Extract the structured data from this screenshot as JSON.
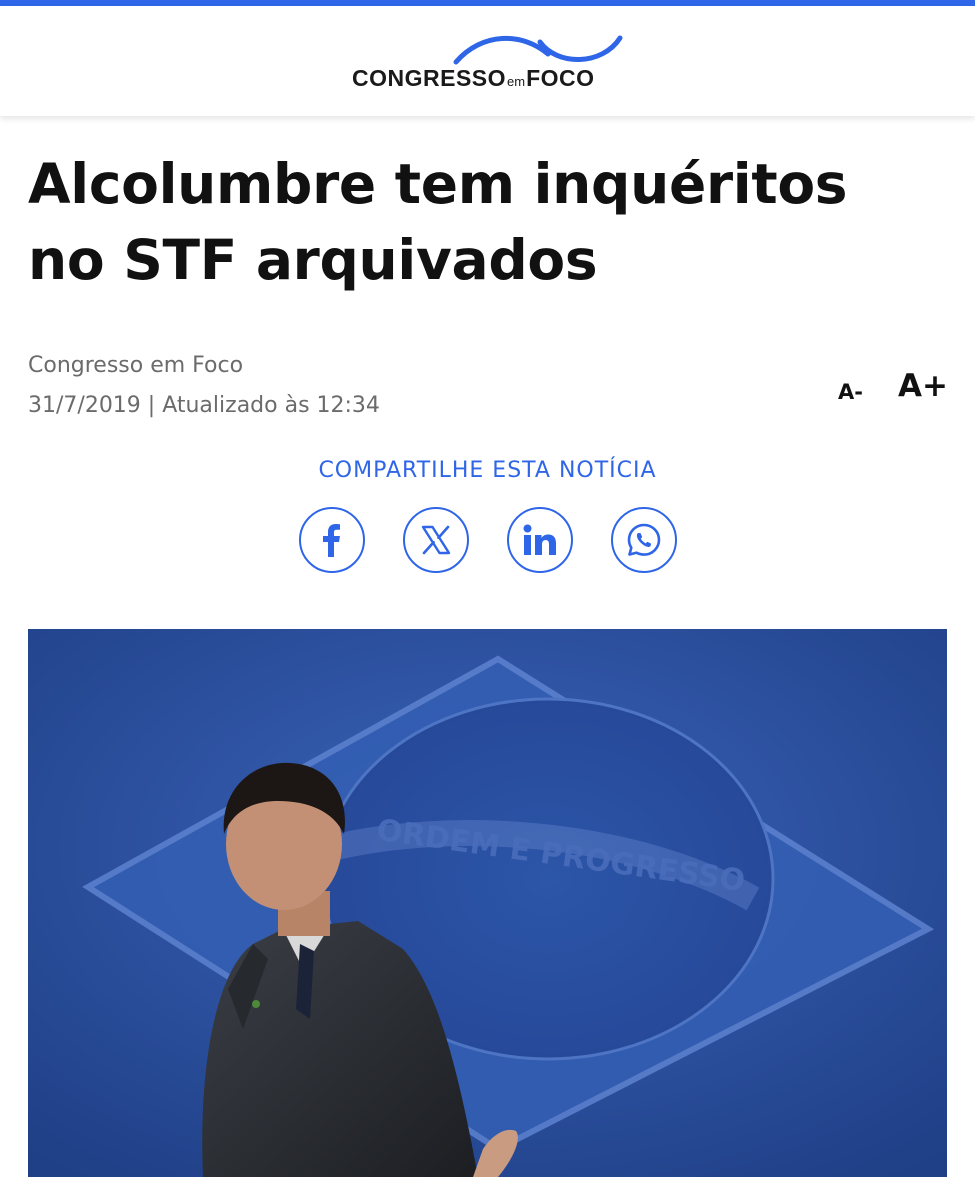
{
  "header": {
    "logo_text_left": "CONGRESSO",
    "logo_text_em": "em",
    "logo_text_right": "FOCO",
    "accent_color": "#2f66e8"
  },
  "article": {
    "title_line1": "Alcolumbre tem inquéritos",
    "title_line2": "no STF arquivados",
    "author": "Congresso em Foco",
    "date": "31/7/2019 | Atualizado às 12:34"
  },
  "font_controls": {
    "decrease_label": "A-",
    "increase_label": "A+"
  },
  "share": {
    "label": "COMPARTILHE ESTA NOTÍCIA",
    "buttons": [
      {
        "icon": "facebook-icon"
      },
      {
        "icon": "x-icon"
      },
      {
        "icon": "linkedin-icon"
      },
      {
        "icon": "whatsapp-icon"
      }
    ]
  }
}
